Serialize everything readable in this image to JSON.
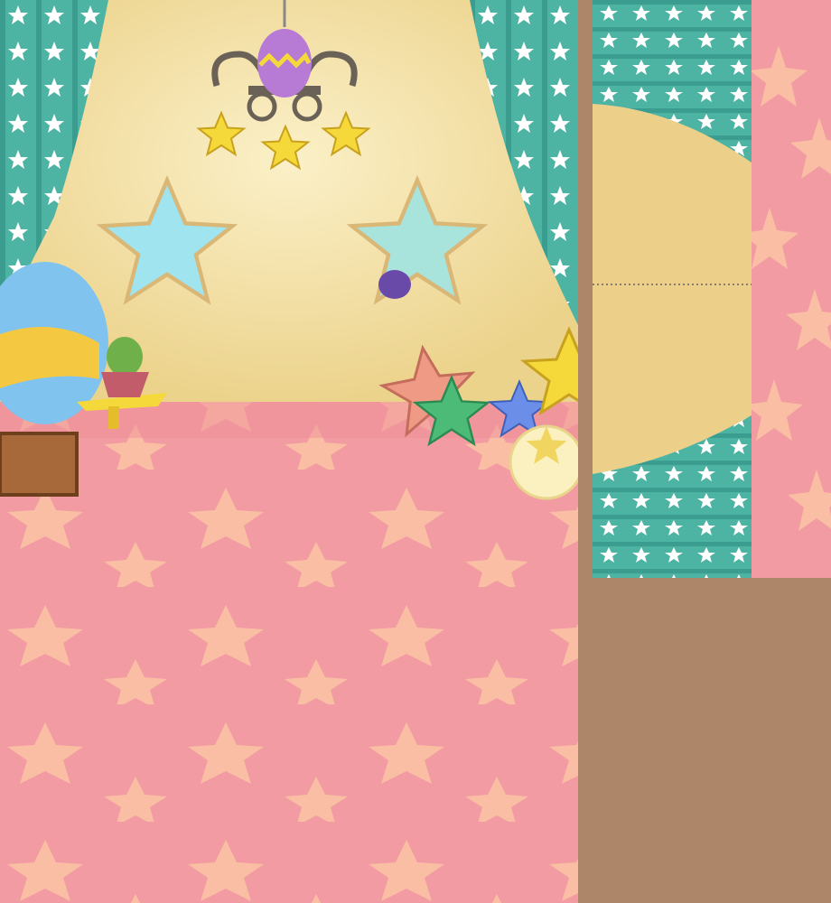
{
  "atlas": {
    "description_type": "game room texture atlas",
    "colors": {
      "background": "#ad8669",
      "wall": "#f6e6b2",
      "wall_shadow": "#ecd38c",
      "floor": "#f29ba2",
      "floor_star": "#f9bea4",
      "curtain": "#4db3a3",
      "curtain_dark": "#2f8f82",
      "star_window_sky": "#9fe4ef",
      "chandelier_egg": "#b77bd6",
      "gold_star": "#f5d83a"
    },
    "icons": [
      "chandelier-icon",
      "star-window-icon",
      "bat-creature-icon",
      "egg-icon",
      "cactus-icon",
      "crate-icon",
      "star-pillow-icon",
      "moon-ball-icon"
    ]
  }
}
